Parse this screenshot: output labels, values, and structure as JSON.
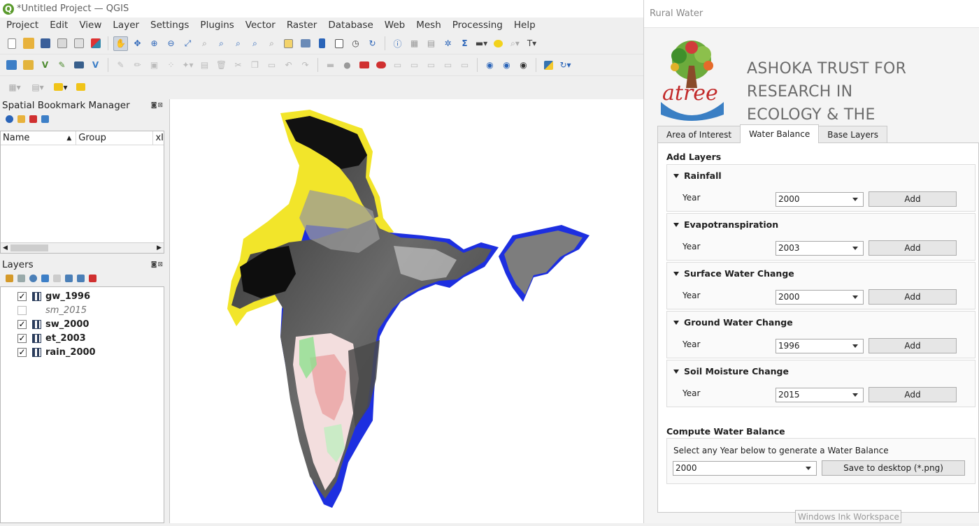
{
  "window": {
    "title": "*Untitled Project — QGIS",
    "logo_letter": "Q"
  },
  "menu": [
    "Project",
    "Edit",
    "View",
    "Layer",
    "Settings",
    "Plugins",
    "Vector",
    "Raster",
    "Database",
    "Web",
    "Mesh",
    "Processing",
    "Help"
  ],
  "bookmarks": {
    "title": "Spatial Bookmark Manager",
    "controls": "◙⊠",
    "columns": [
      "Name",
      "Group",
      "xI"
    ],
    "scroll_left": "◀",
    "scroll_right": "▶"
  },
  "layers_panel": {
    "title": "Layers",
    "controls": "◙⊠",
    "check_mark": "✓",
    "items": [
      {
        "name": "gw_1996",
        "checked": true
      },
      {
        "name": "sm_2015",
        "checked": false
      },
      {
        "name": "sw_2000",
        "checked": true
      },
      {
        "name": "et_2003",
        "checked": true
      },
      {
        "name": "rain_2000",
        "checked": true
      }
    ]
  },
  "dialog": {
    "title": "Rural Water",
    "org_line1": "ASHOKA TRUST FOR RESEARCH IN",
    "org_line2": "ECOLOGY  & THE ENVIRONMENT",
    "logo_text": "atree",
    "tabs": [
      "Area of Interest",
      "Water Balance",
      "Base Layers"
    ],
    "active_tab": "Water Balance",
    "add_layers_label": "Add Layers",
    "sections": [
      {
        "title": "Rainfall",
        "year_label": "Year",
        "year": "2000",
        "button": "Add"
      },
      {
        "title": "Evapotranspiration",
        "year_label": "Year",
        "year": "2003",
        "button": "Add"
      },
      {
        "title": "Surface Water Change",
        "year_label": "Year",
        "year": "2000",
        "button": "Add"
      },
      {
        "title": "Ground Water Change",
        "year_label": "Year",
        "year": "1996",
        "button": "Add"
      },
      {
        "title": "Soil Moisture Change",
        "year_label": "Year",
        "year": "2015",
        "button": "Add"
      }
    ],
    "compute": {
      "label": "Compute Water Balance",
      "hint": "Select any Year below to generate a Water Balance",
      "year": "2000",
      "save_button": "Save to desktop (*.png)"
    }
  },
  "ink_workspace": "Windows Ink Workspace"
}
